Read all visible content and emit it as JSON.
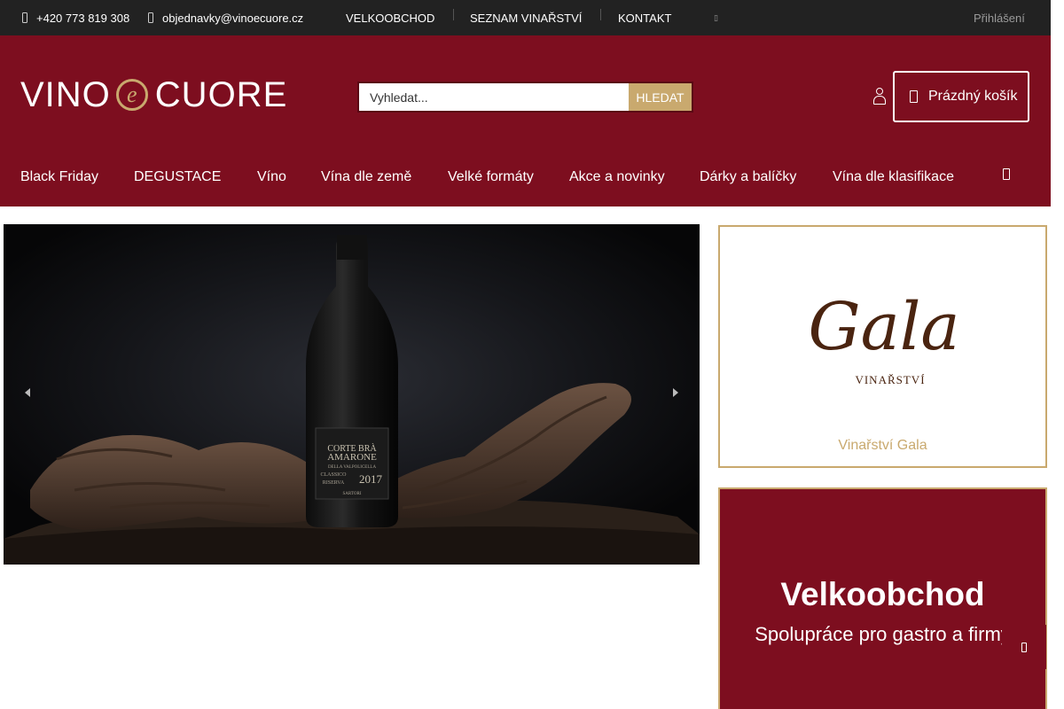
{
  "topbar": {
    "phone": "+420 773 819 308",
    "email": "objednavky@vinoecuore.cz",
    "links": [
      "VELKOOBCHOD",
      "SEZNAM VINAŘSTVÍ",
      "KONTAKT"
    ],
    "login": "Přihlášení"
  },
  "header": {
    "logo_left": "VINO",
    "logo_mark": "e",
    "logo_right": "CUORE",
    "search_placeholder": "Vyhledat...",
    "search_button": "HLEDAT",
    "cart_label": "Prázdný košík"
  },
  "nav": {
    "items": [
      "Black Friday",
      "DEGUSTACE",
      "Víno",
      "Vína dle země",
      "Velké formáty",
      "Akce a novinky",
      "Dárky a balíčky",
      "Vína dle klasifikace"
    ]
  },
  "slider": {
    "label_lines": [
      "CORTE BRÀ",
      "AMARONE",
      "DELLA VALPOLICELLA",
      "CLASSICO",
      "RISERVA",
      "2017",
      "SARTORI"
    ]
  },
  "sidebar": {
    "gala_logo_text": "Gala",
    "gala_logo_sub": "VINAŘSTVÍ",
    "gala_caption": "Vinařství Gala",
    "wholesale_title": "Velkoobchod",
    "wholesale_subtitle": "Spolupráce pro gastro a firmy"
  },
  "colors": {
    "brand": "#7d0e1f",
    "gold": "#c9a96e",
    "topbar": "#222222"
  }
}
